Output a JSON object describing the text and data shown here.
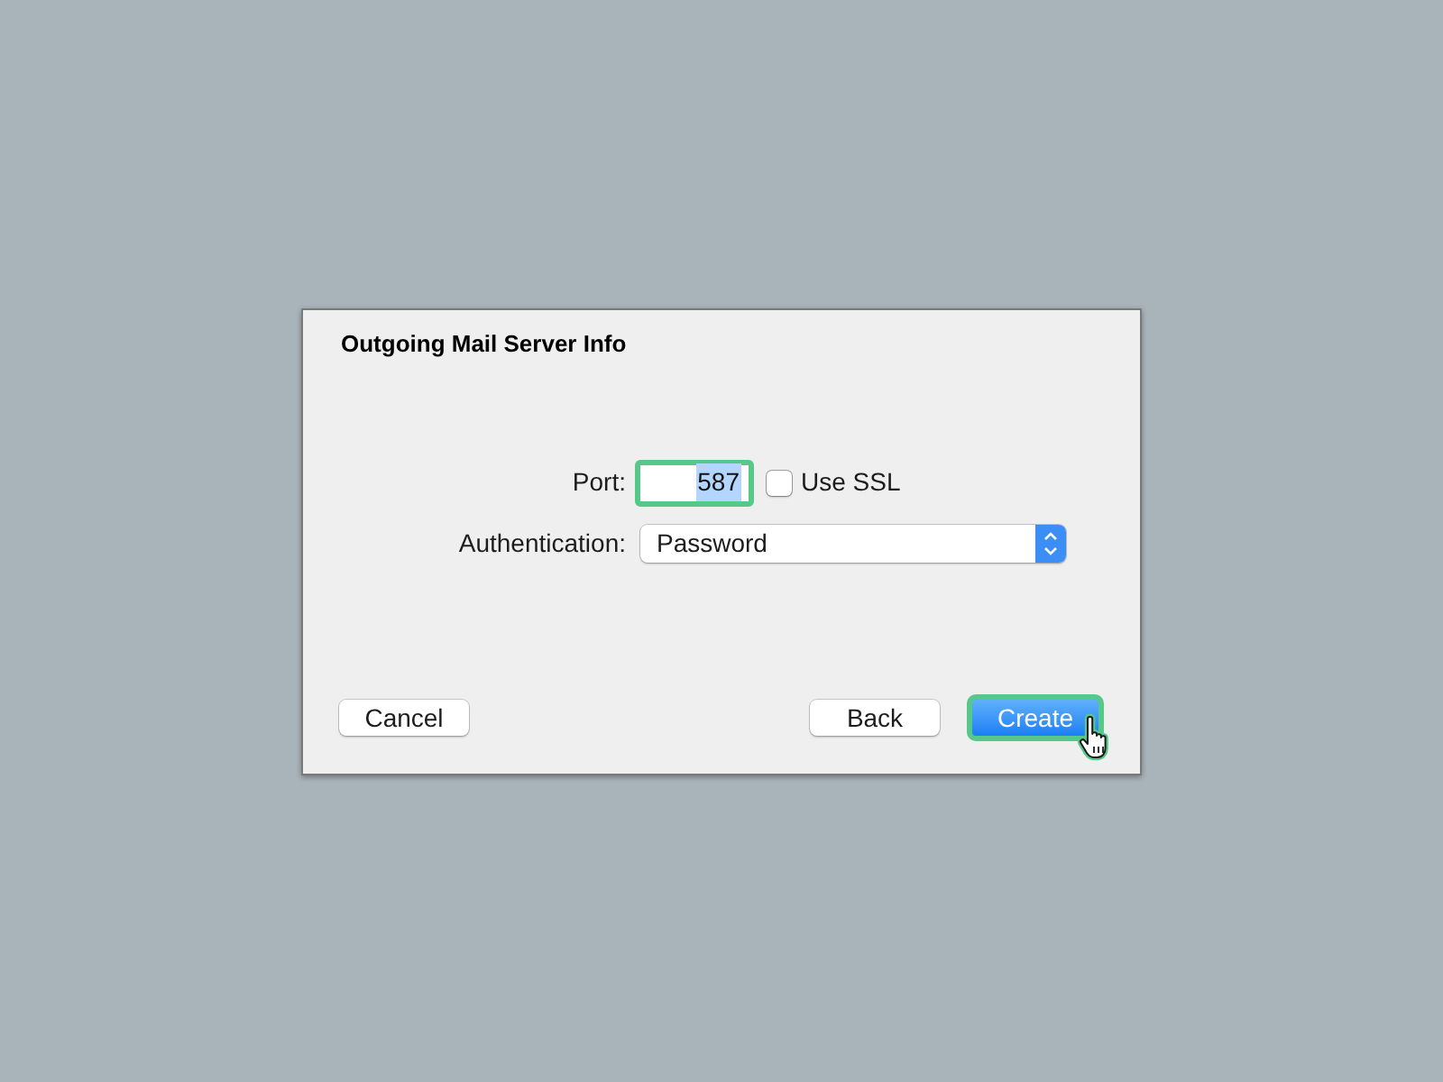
{
  "dialog": {
    "title": "Outgoing Mail Server Info"
  },
  "form": {
    "port": {
      "label": "Port:",
      "value": "587",
      "value_selected": true,
      "highlighted": true
    },
    "use_ssl": {
      "label": "Use SSL",
      "checked": false
    },
    "authentication": {
      "label": "Authentication:",
      "value": "Password"
    }
  },
  "buttons": [
    {
      "label": "Cancel",
      "kind": "plain",
      "highlighted": false,
      "cursor": false
    },
    {
      "label": "Back",
      "kind": "plain",
      "highlighted": false,
      "cursor": false
    },
    {
      "label": "Create",
      "kind": "default",
      "highlighted": true,
      "cursor": true
    }
  ]
}
